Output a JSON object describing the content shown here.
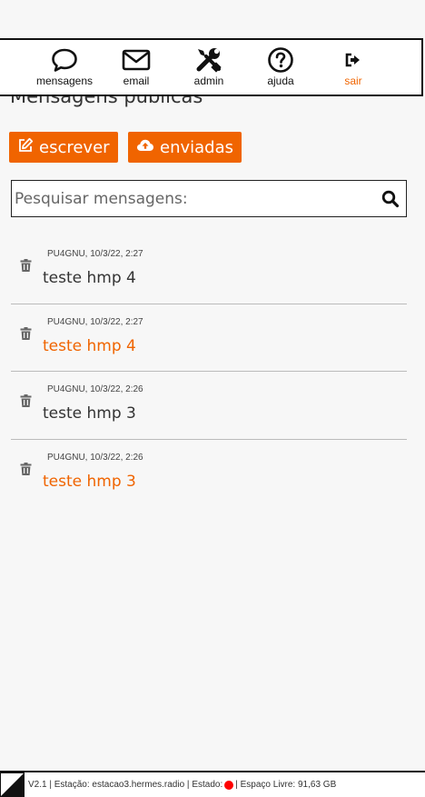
{
  "nav": {
    "items": [
      {
        "label": "mensagens",
        "icon": "chat-bubble-icon"
      },
      {
        "label": "email",
        "icon": "envelope-icon"
      },
      {
        "label": "admin",
        "icon": "tools-icon"
      },
      {
        "label": "ajuda",
        "icon": "help-icon"
      },
      {
        "label": "sair",
        "icon": "sign-out-icon"
      }
    ]
  },
  "page": {
    "title": "Mensagens públicas"
  },
  "actions": {
    "write_label": "escrever",
    "sent_label": "enviadas"
  },
  "search": {
    "placeholder": "Pesquisar mensagens:"
  },
  "messages": [
    {
      "meta": "PU4GNU, 10/3/22, 2:27",
      "subject": "teste hmp 4",
      "unread": false
    },
    {
      "meta": "PU4GNU, 10/3/22, 2:27",
      "subject": "teste hmp 4",
      "unread": true
    },
    {
      "meta": "PU4GNU, 10/3/22, 2:26",
      "subject": "teste hmp 3",
      "unread": false
    },
    {
      "meta": "PU4GNU, 10/3/22, 2:26",
      "subject": "teste hmp 3",
      "unread": true
    }
  ],
  "footer": {
    "version": "V2.1",
    "station": "Estação: estacao3.hermes.radio",
    "state_label": "Estado:",
    "free_space": "Espaço Livre: 91,63 GB"
  },
  "colors": {
    "accent": "#f06400",
    "status": "#ff0000"
  }
}
